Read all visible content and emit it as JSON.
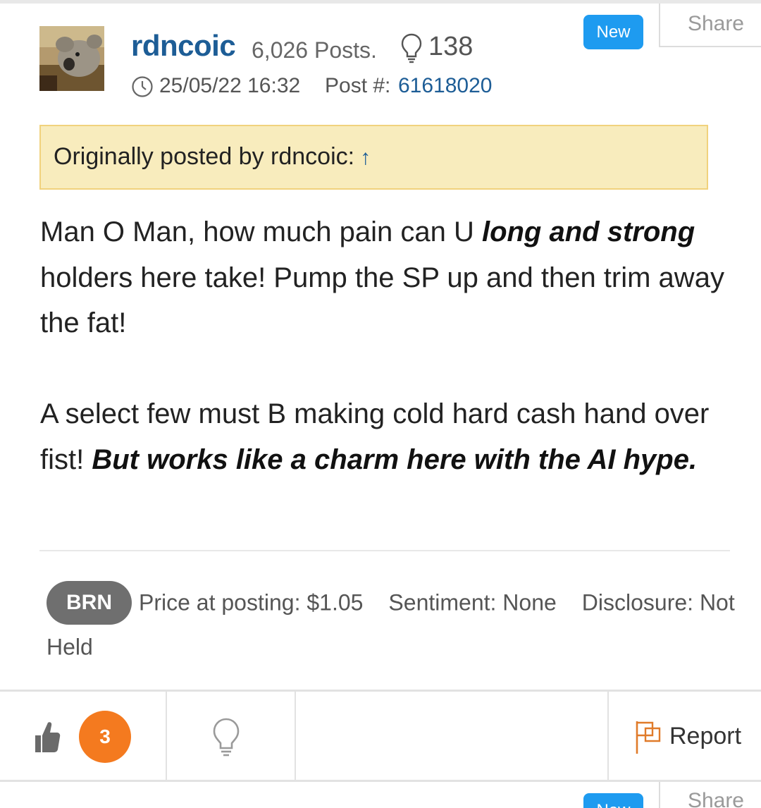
{
  "post": {
    "share_label": "Share",
    "new_badge": "New",
    "author": {
      "username": "rdncoic",
      "posts_count": "6,026 Posts.",
      "likes_count": "138"
    },
    "timestamp": "25/05/22 16:32",
    "post_number_label": "Post #:",
    "post_number": "61618020",
    "quote": {
      "text": "Originally posted by rdncoic:",
      "arrow": "↑"
    },
    "body": {
      "p1_a": "Man O Man, how much pain can U ",
      "p1_em": "long and strong",
      "p1_b": " holders here take! Pump the SP up and then trim away the fat!",
      "p2_a": "A select few must B making cold hard cash hand over fist! ",
      "p2_em": "But works like a charm here with the AI hype."
    },
    "meta": {
      "ticker": "BRN",
      "price": "Price at posting: $1.05",
      "sentiment": "Sentiment: None",
      "disclosure": "Disclosure: Not Held"
    },
    "actions": {
      "like_count": "3",
      "report_label": "Report"
    }
  },
  "next_post": {
    "new_badge": "New",
    "share_label": "Share"
  },
  "colors": {
    "link_blue": "#1d5d96",
    "badge_blue": "#1e9bf0",
    "like_orange": "#f47a1f",
    "quote_bg": "#f8ecbd",
    "quote_border": "#f1d27d",
    "ticker_gray": "#6f6f6f"
  }
}
